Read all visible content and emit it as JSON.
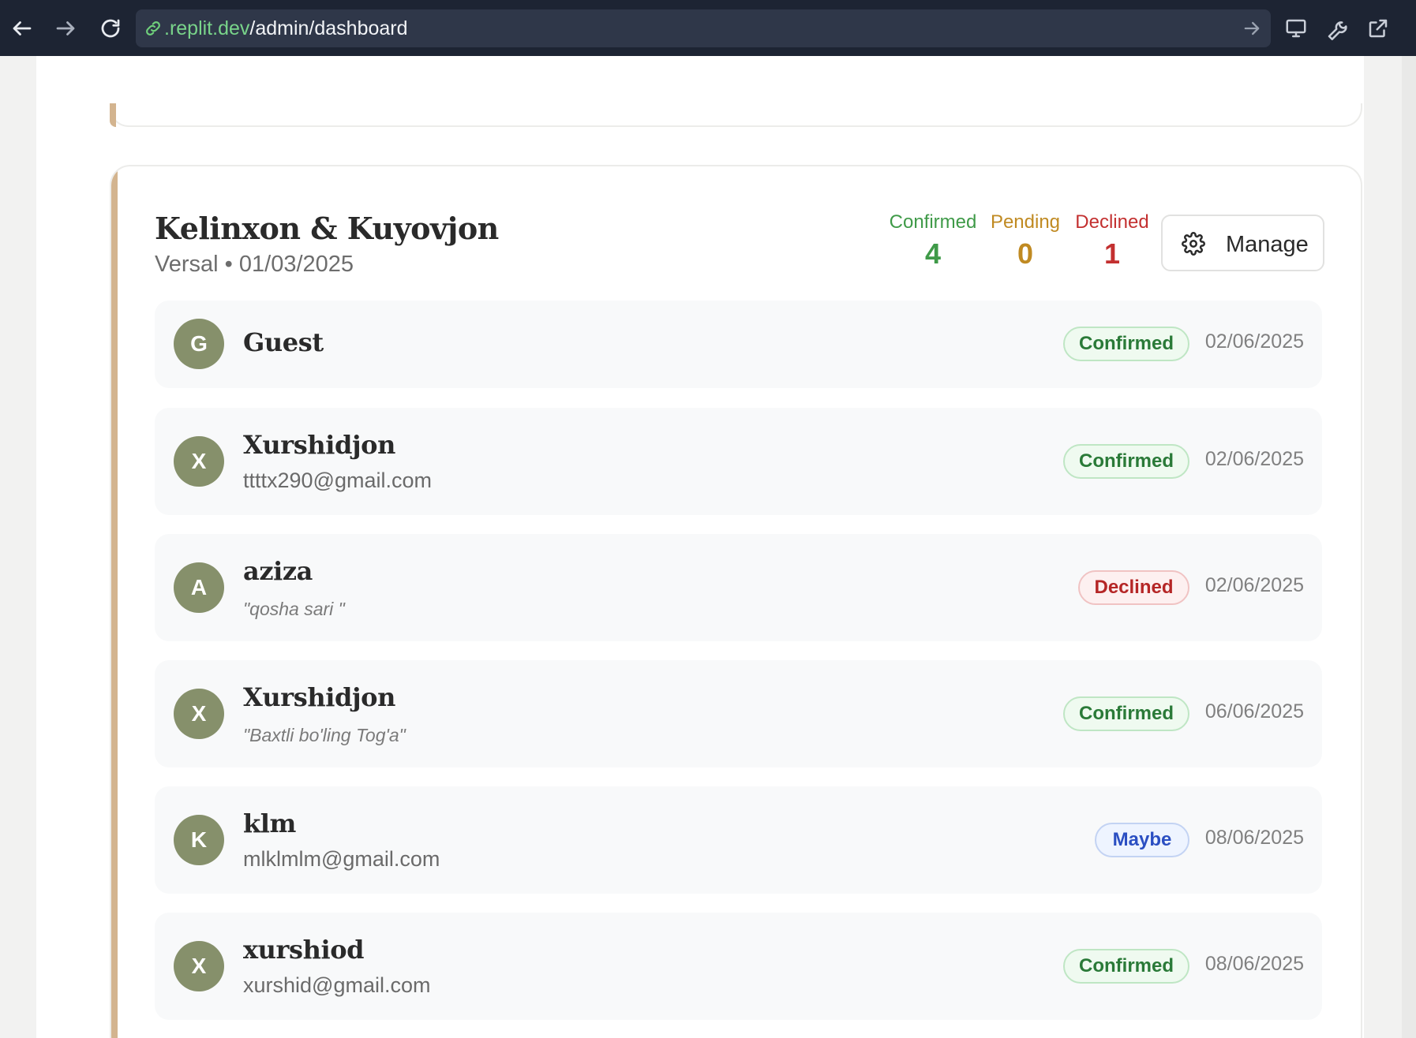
{
  "browser": {
    "url_host": ".replit.dev",
    "url_path": "/admin/dashboard",
    "icons": [
      "back-arrow-icon",
      "forward-arrow-icon",
      "reload-icon",
      "link-icon",
      "go-arrow-icon",
      "monitor-icon",
      "wrench-icon",
      "external-link-icon"
    ]
  },
  "card": {
    "title": "Kelinxon & Kuyovjon",
    "venue": "Versal",
    "separator": "•",
    "date": "01/03/2025",
    "stats": {
      "confirmed_label": "Confirmed",
      "confirmed_value": "4",
      "pending_label": "Pending",
      "pending_value": "0",
      "declined_label": "Declined",
      "declined_value": "1"
    },
    "manage_label": "Manage",
    "accent_color": "#d3b48f"
  },
  "guests": [
    {
      "initial": "G",
      "name": "Guest",
      "status": "Confirmed",
      "date": "02/06/2025"
    },
    {
      "initial": "X",
      "name": "Xurshidjon",
      "email": "ttttx290@gmail.com",
      "status": "Confirmed",
      "date": "02/06/2025"
    },
    {
      "initial": "A",
      "name": "aziza",
      "note": "\"qosha sari \"",
      "status": "Declined",
      "date": "02/06/2025"
    },
    {
      "initial": "X",
      "name": "Xurshidjon",
      "note": "\"Baxtli bo'ling Tog'a\"",
      "status": "Confirmed",
      "date": "06/06/2025"
    },
    {
      "initial": "K",
      "name": "klm",
      "email": "mlklmlm@gmail.com",
      "status": "Maybe",
      "date": "08/06/2025"
    },
    {
      "initial": "X",
      "name": "xurshiod",
      "email": "xurshid@gmail.com",
      "status": "Confirmed",
      "date": "08/06/2025"
    }
  ],
  "colors": {
    "confirmed": "#3f9a48",
    "pending": "#c08a22",
    "declined": "#c33030",
    "maybe": "#2b4fc2",
    "avatar": "#86906b"
  }
}
